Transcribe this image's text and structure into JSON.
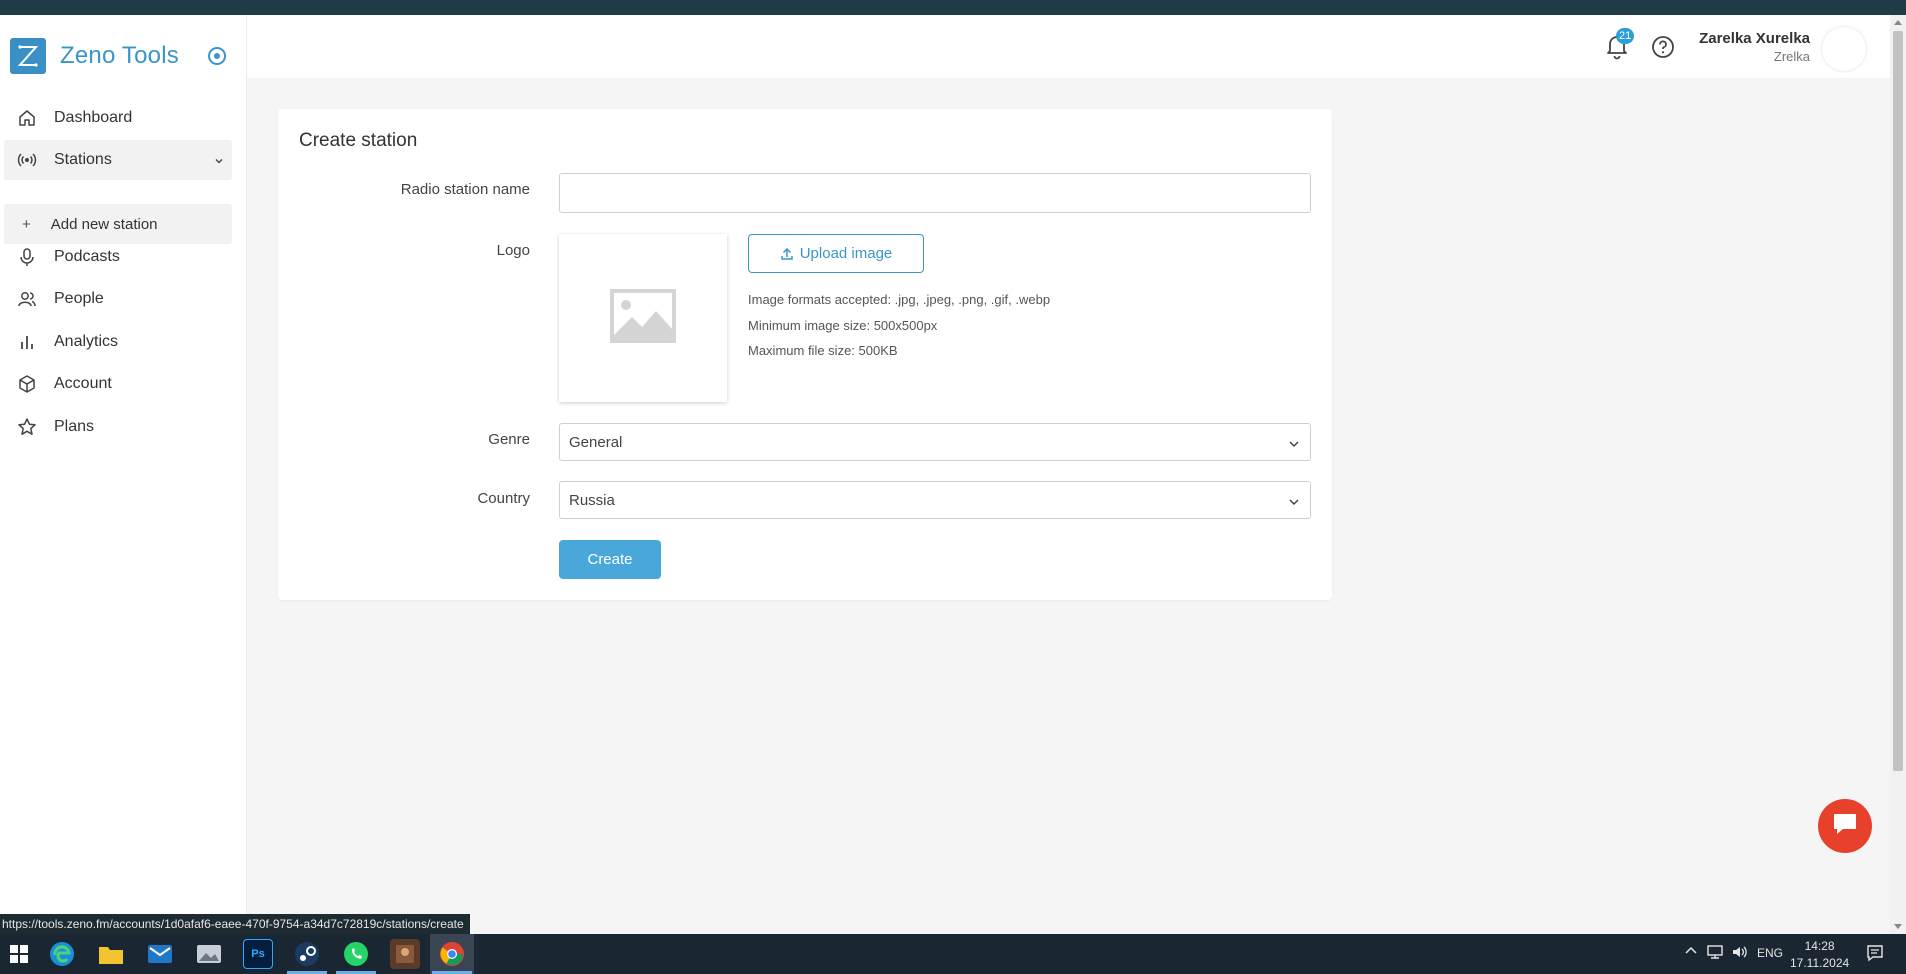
{
  "app": {
    "brand_name": "Zeno Tools"
  },
  "sidebar": {
    "items": [
      {
        "label": "Dashboard",
        "icon": "home-icon"
      },
      {
        "label": "Stations",
        "icon": "broadcast-icon"
      },
      {
        "label": "Podcasts",
        "icon": "microphone-icon"
      },
      {
        "label": "People",
        "icon": "people-icon"
      },
      {
        "label": "Analytics",
        "icon": "bar-chart-icon"
      },
      {
        "label": "Account",
        "icon": "cube-icon"
      },
      {
        "label": "Plans",
        "icon": "star-icon"
      }
    ],
    "subitem": {
      "label": "Add new station",
      "icon": "plus-icon",
      "plus": "+"
    }
  },
  "header": {
    "notification_count": "21",
    "user_name": "Zarelka Xurelka",
    "user_sub": "Zrelka"
  },
  "form": {
    "title": "Create station",
    "name_label": "Radio station name",
    "name_value": "",
    "logo_label": "Logo",
    "upload_label": "Upload image",
    "hints": [
      "Image formats accepted: .jpg, .jpeg, .png, .gif, .webp",
      "Minimum image size: 500x500px",
      "Maximum file size: 500KB"
    ],
    "genre_label": "Genre",
    "genre_value": "General",
    "country_label": "Country",
    "country_value": "Russia",
    "create_label": "Create"
  },
  "status_bar": {
    "url": "https://tools.zeno.fm/accounts/1d0afaf6-eaee-470f-9754-a34d7c72819c/stations/create"
  },
  "taskbar": {
    "apps": [
      "windows-start",
      "edge",
      "file-explorer",
      "outlook",
      "photos",
      "photoshop",
      "steam",
      "whatsapp",
      "game",
      "chrome"
    ],
    "photoshop_label": "Ps",
    "language": "ENG",
    "time": "14:28",
    "date": "17.11.2024"
  },
  "colors": {
    "accent": "#3a96c9",
    "button": "#4aa7da",
    "chat": "#e8412b"
  }
}
